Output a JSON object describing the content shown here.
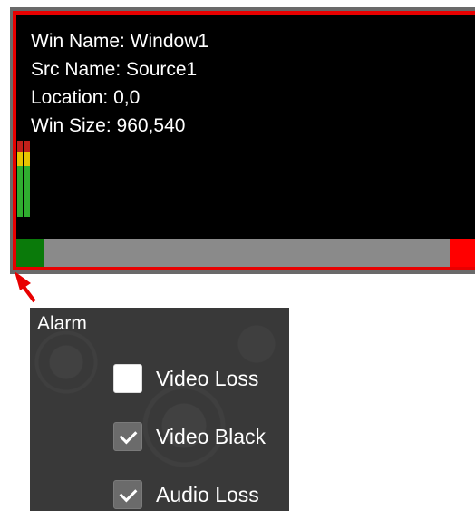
{
  "window_info": {
    "win_name": "Win Name:  Window1",
    "src_name": "Src Name:  Source1",
    "location": "Location:  0,0",
    "win_size": "Win Size:  960,540"
  },
  "alarm": {
    "title": "Alarm",
    "items": [
      {
        "label": "Video Loss",
        "checked": false
      },
      {
        "label": "Video Black",
        "checked": true
      },
      {
        "label": "Audio Loss",
        "checked": true
      }
    ]
  },
  "colors": {
    "border_red": "#e80000",
    "status_green": "#0a7a0a",
    "status_red": "#ff0000",
    "panel_bg": "#393939"
  }
}
